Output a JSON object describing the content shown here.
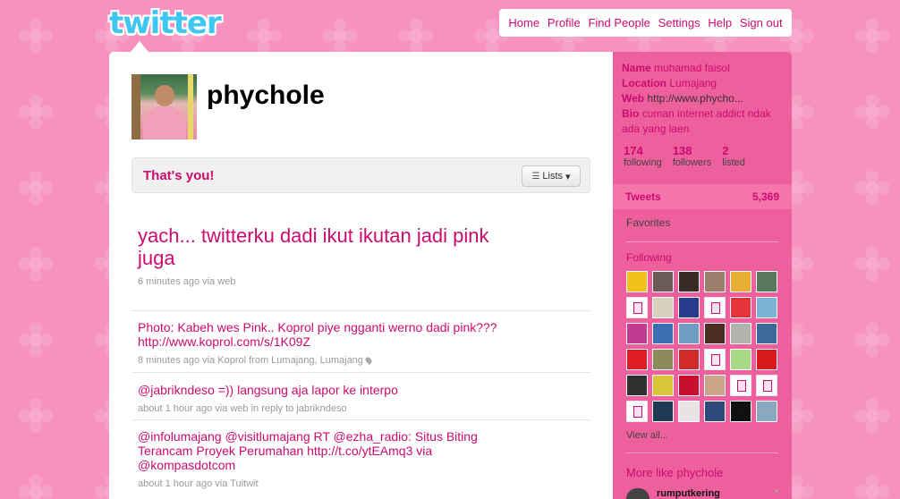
{
  "header": {
    "logo": "twitter",
    "nav": [
      "Home",
      "Profile",
      "Find People",
      "Settings",
      "Help",
      "Sign out"
    ]
  },
  "profile": {
    "screen_name": "phychole",
    "thats_you": "That's you!",
    "lists_button": "Lists"
  },
  "latest_tweet": {
    "text": "yach... twitterku dadi ikut ikutan jadi pink juga",
    "meta": "6 minutes ago via web"
  },
  "timeline": [
    {
      "text": "Photo: Kabeh wes Pink.. Koprol piye ngganti werno dadi pink??? http://www.koprol.com/s/1K09Z",
      "meta": "8 minutes ago via Koprol from Lumajang, Lumajang"
    },
    {
      "text": "@jabrikndeso =)) langsung aja lapor ke interpo",
      "meta": "about 1 hour ago via web in reply to jabrikndeso"
    },
    {
      "text": "@infolumajang @visitlumajang RT @ezha_radio: Situs Biting Terancam Proyek Perumahan http://t.co/ytEAmq3 via @kompasdotcom",
      "meta": "about 1 hour ago via Tuitwit"
    }
  ],
  "sidebar": {
    "name_label": "Name",
    "name": "muhamad faisol",
    "location_label": "Location",
    "location": "Lumajang",
    "web_label": "Web",
    "web": "http://www.phycho...",
    "bio_label": "Bio",
    "bio": "cuman internet addict ndak ada yang laen",
    "stats": [
      {
        "count": "174",
        "label": "following"
      },
      {
        "count": "138",
        "label": "followers"
      },
      {
        "count": "2",
        "label": "listed"
      }
    ],
    "tweets_label": "Tweets",
    "tweets_count": "5,369",
    "favorites": "Favorites",
    "following_title": "Following",
    "view_all": "View all...",
    "more_like": "More like phychole",
    "suggestion_name": "rumputkering",
    "suggestion_close": "×"
  },
  "following_thumbs": [
    "#f2c21b",
    "#6b5a55",
    "#3a2a26",
    "#9b7e6b",
    "#e8b032",
    "#58785c",
    "blank",
    "#d9d1c0",
    "#2a3a8c",
    "blank",
    "#e8333a",
    "#7ab3d6",
    "#c13a8f",
    "#3b6fb4",
    "#6f9cc2",
    "#4c2d22",
    "#b3b1ae",
    "#3b6a9a",
    "#e11b22",
    "#8a8a5a",
    "#d22a2a",
    "blank",
    "#a8d986",
    "#d91a1a",
    "#2f2f2f",
    "#d9c43a",
    "#c8102e",
    "#caa58a",
    "blank",
    "blank",
    "blank",
    "#1e3a55",
    "#e9e3e3",
    "#2c4a7a",
    "#111111",
    "#8aa8c0"
  ],
  "colors": {
    "accent": "#cc0b6e",
    "background": "#f791c0",
    "sidebar": "#ee5f9e",
    "logo": "#3fc7f2"
  }
}
